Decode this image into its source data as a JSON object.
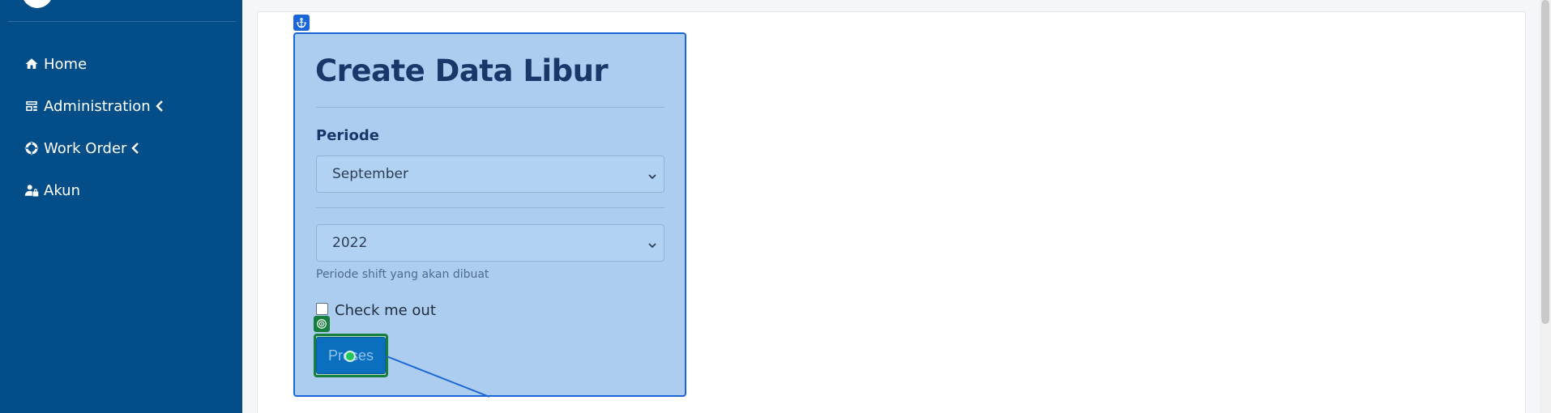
{
  "sidebar": {
    "items": [
      {
        "label": "Home",
        "icon": "home-icon",
        "has_submenu": false
      },
      {
        "label": "Administration",
        "icon": "admin-icon",
        "has_submenu": true
      },
      {
        "label": "Work Order",
        "icon": "work-order-icon",
        "has_submenu": true
      },
      {
        "label": "Akun",
        "icon": "user-lock-icon",
        "has_submenu": false
      }
    ]
  },
  "form": {
    "title": "Create Data Libur",
    "periode_label": "Periode",
    "month_value": "September",
    "year_value": "2022",
    "help_text": "Periode shift yang akan dibuat",
    "checkbox_label": "Check me out",
    "checkbox_checked": false,
    "submit_label": "Proses"
  },
  "colors": {
    "sidebar_bg": "#034e89",
    "highlight_overlay": "#accdf0",
    "highlight_border": "#1a66d6",
    "target_border": "#15803d",
    "button_bg": "#0b6fc0"
  }
}
